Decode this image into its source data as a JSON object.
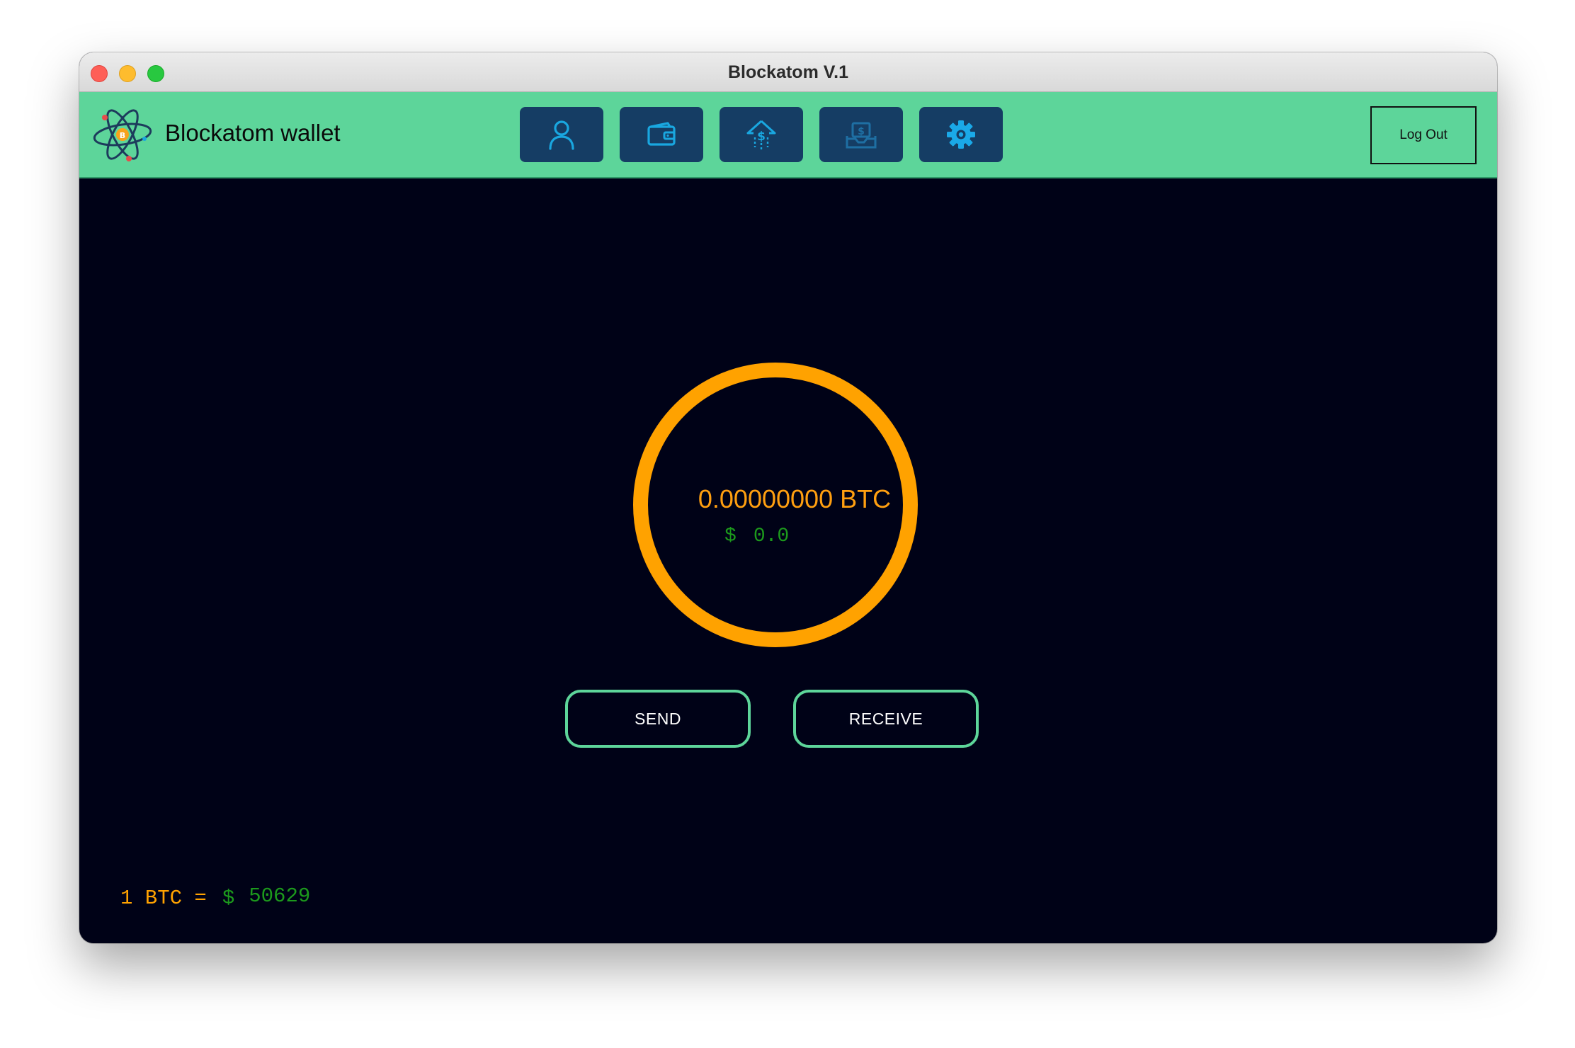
{
  "window": {
    "title": "Blockatom V.1"
  },
  "header": {
    "brand": "Blockatom wallet",
    "logout_label": "Log Out",
    "nav": [
      {
        "icon": "user-icon"
      },
      {
        "icon": "wallet-icon"
      },
      {
        "icon": "send-money-icon"
      },
      {
        "icon": "receive-money-icon"
      },
      {
        "icon": "gear-icon"
      }
    ]
  },
  "balance": {
    "btc": "0.00000000 BTC",
    "usd_symbol": "$",
    "usd_value": "0.0"
  },
  "actions": {
    "send_label": "SEND",
    "receive_label": "RECEIVE"
  },
  "rate": {
    "label": "1 BTC =",
    "symbol": "$",
    "value": "50629"
  },
  "colors": {
    "header": "#5dd59a",
    "background": "#000217",
    "nav_button": "#153d64",
    "icon": "#19a7e0",
    "ring": "#ffa200",
    "usd": "#1c9a1c"
  }
}
